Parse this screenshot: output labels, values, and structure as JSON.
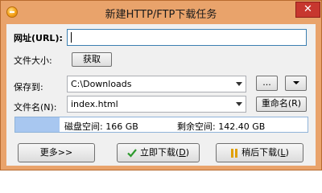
{
  "window": {
    "title": "新建HTTP/FTP下载任务",
    "close_glyph": "✕"
  },
  "url": {
    "label": "网址(URL):",
    "value": ""
  },
  "filesize": {
    "label": "文件大小:",
    "get_button": "获取"
  },
  "save_to": {
    "label": "保存到:",
    "value": "C:\\Downloads",
    "browse_button": "..."
  },
  "filename": {
    "label": "文件名(N):",
    "value": "index.html",
    "rename_button": "重命名(R)"
  },
  "disk": {
    "space_text": "磁盘空间: 166 GB",
    "free_text": "剩余空间: 142.40 GB"
  },
  "buttons": {
    "more": "更多>>",
    "download_now": "立即下载",
    "download_now_key": "D",
    "download_later": "稍后下载",
    "download_later_key": "L"
  },
  "icons": {
    "app": "app-icon",
    "check": "check-icon",
    "pause": "pause-icon"
  }
}
